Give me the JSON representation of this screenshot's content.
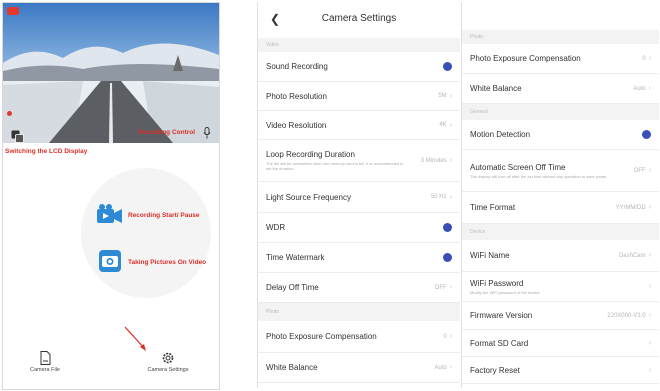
{
  "left_panel": {
    "labels": {
      "switch_lcd": "Switching the LCD Display",
      "recording_control": "Recording Control",
      "recording_start_pause": "Recording Start/ Pause",
      "taking_pictures": "Taking Pictures On Video"
    },
    "nav": {
      "camera_file": "Camera File",
      "camera_settings": "Camera Settings"
    }
  },
  "settings": {
    "title": "Camera Settings",
    "section_video": "Video",
    "sound_recording": "Sound Recording",
    "photo_resolution": "Photo Resolution",
    "photo_resolution_value": "5M",
    "video_resolution": "Video Resolution",
    "video_resolution_value": "4K",
    "loop_recording": "Loop Recording Duration",
    "loop_recording_desc": "The file will be overwritten when the memory card is full. It is recommended to set the duration",
    "loop_recording_value": "3 Minutes",
    "light_source": "Light Source Frequency",
    "light_source_value": "50 Hz",
    "wdr": "WDR",
    "time_watermark": "Time Watermark",
    "delay_off": "Delay Off Time",
    "delay_off_value": "OFF",
    "section_photo": "Photo",
    "photo_exposure": "Photo Exposure Compensation",
    "photo_exposure_value": "0",
    "white_balance": "White Balance",
    "white_balance_value": "Auto"
  },
  "settings_right": {
    "section_photo": "Photo",
    "photo_exposure": "Photo Exposure Compensation",
    "photo_exposure_value": "0",
    "white_balance": "White Balance",
    "white_balance_value": "Auto",
    "section_general": "General",
    "motion_detection": "Motion Detection",
    "auto_screen_off": "Automatic Screen Off Time",
    "auto_screen_off_desc": "The display will turn off after the set time without any operation to save power",
    "auto_screen_off_value": "OFF",
    "time_format": "Time Format",
    "time_format_value": "YY/MM/DD",
    "section_device": "Device",
    "wifi_name": "WiFi Name",
    "wifi_name_value": "DashCam",
    "wifi_password": "WiFi Password",
    "wifi_password_desc": "Modify the WiFi password of the device",
    "firmware_version": "Firmware Version",
    "firmware_version_value": "220X000-V3.0",
    "format_sd": "Format SD Card",
    "factory_reset": "Factory Reset"
  },
  "colors": {
    "accent_red": "#d9302a",
    "toggle_blue": "#3a4fb5",
    "icon_blue": "#2f8ad6"
  },
  "toggles": {
    "sound_recording": true,
    "wdr": true,
    "time_watermark": true,
    "motion_detection": true
  }
}
